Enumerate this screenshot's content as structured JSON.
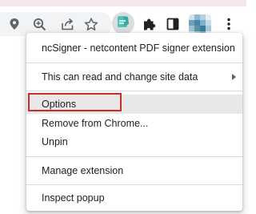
{
  "toolbar": {
    "icons": [
      "location-icon",
      "zoom-icon",
      "share-icon",
      "bookmark-star-icon",
      "ncsigner-extension-icon",
      "extensions-puzzle-icon",
      "side-panel-icon",
      "profile-avatar",
      "more-menu-icon"
    ]
  },
  "menu": {
    "title": "ncSigner - netcontent PDF signer extension",
    "site_data": "This can read and change site data",
    "options": "Options",
    "remove": "Remove from Chrome...",
    "unpin": "Unpin",
    "manage": "Manage extension",
    "inspect": "Inspect popup"
  },
  "colors": {
    "highlight_box": "#cc2b2b",
    "hover_background": "#e8e8e8",
    "extension_teal": "#4fc3b8"
  }
}
